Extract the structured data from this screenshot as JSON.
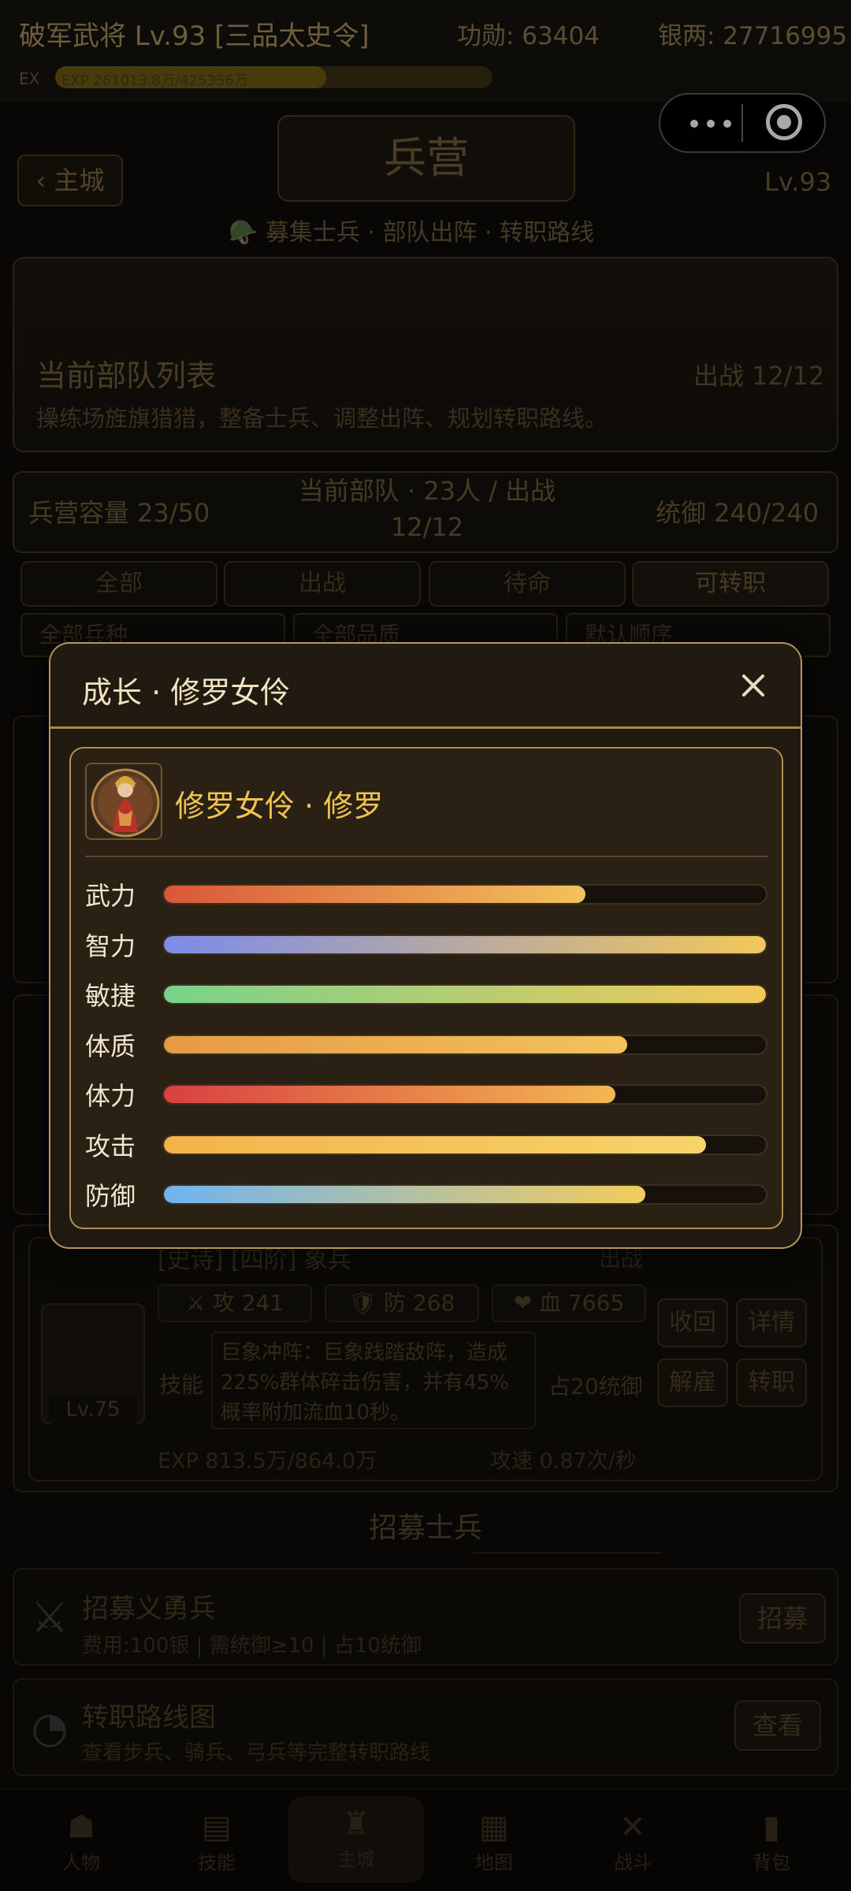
{
  "top": {
    "title": "破军武将 Lv.93 [三品太史令]",
    "merit": "功勋: 63404",
    "silver": "银两: 27716995",
    "exp_label": "EX",
    "exp_text": "EXP 261013.8万/425356万",
    "exp_fraction": 0.62
  },
  "header": {
    "back_label": "‹ 主城",
    "title": "兵营",
    "level": "Lv.93",
    "subnav": "🪖 募集士兵 · 部队出阵 · 转职路线"
  },
  "banner": {
    "title": "当前部队列表",
    "count": "出战 12/12",
    "desc": "操练场旌旗猎猎，整备士兵、调整出阵、规划转职路线。"
  },
  "info_row": {
    "capacity": "兵营容量 23/50",
    "current": "当前部队 · 23人 / 出战12/12",
    "leadership": "统御 240/240"
  },
  "tabs": [
    "全部",
    "出战",
    "待命",
    "可转职"
  ],
  "filters": [
    "全部兵种",
    "全部品质",
    "默认顺序"
  ],
  "unit": {
    "name": "[史诗] [四阶] 象兵",
    "state": "出战",
    "attack": "⚔ 攻 241",
    "defense": "🛡 防 268",
    "hp": "❤ 血 7665",
    "level": "Lv.75",
    "skill_label": "技能",
    "skill_text": "巨象冲阵：巨象践踏敌阵，造成225%群体碎击伤害，并有45%概率附加流血10秒。",
    "cost": "占20统御",
    "actions": [
      "收回",
      "详情",
      "解雇",
      "转职"
    ],
    "exp": "EXP 813.5万/864.0万",
    "speed": "攻速 0.87次/秒"
  },
  "recruit": {
    "section_title": "招募士兵",
    "militia_title": "招募义勇兵",
    "militia_sub": "费用:100银 | 需统御≥10 | 占10统御",
    "militia_button": "招募",
    "route_title": "转职路线图",
    "route_sub": "查看步兵、骑兵、弓兵等完整转职路线",
    "route_button": "查看"
  },
  "nav": [
    "人物",
    "技能",
    "主城",
    "地图",
    "战斗",
    "背包"
  ],
  "modal": {
    "title": "成长 · 修罗女伶",
    "hero_name": "修罗女伶 · 修罗",
    "stats": [
      {
        "label": "武力",
        "value": 0.7,
        "colors": [
          "#d9573a",
          "#f2c25c"
        ]
      },
      {
        "label": "智力",
        "value": 1.0,
        "colors": [
          "#7b8ce8",
          "#f3c75a"
        ]
      },
      {
        "label": "敏捷",
        "value": 1.0,
        "colors": [
          "#78d28a",
          "#f3c85a"
        ]
      },
      {
        "label": "体质",
        "value": 0.77,
        "colors": [
          "#e69a45",
          "#f3c25a"
        ]
      },
      {
        "label": "体力",
        "value": 0.75,
        "colors": [
          "#d94040",
          "#f3b852"
        ]
      },
      {
        "label": "攻击",
        "value": 0.9,
        "colors": [
          "#f3b34a",
          "#f8d46a"
        ]
      },
      {
        "label": "防御",
        "value": 0.8,
        "colors": [
          "#6fb4ef",
          "#f3cc5c"
        ]
      }
    ]
  },
  "colors": {
    "accent_gold": "#f0c44f",
    "modal_border": "#b8955a"
  }
}
